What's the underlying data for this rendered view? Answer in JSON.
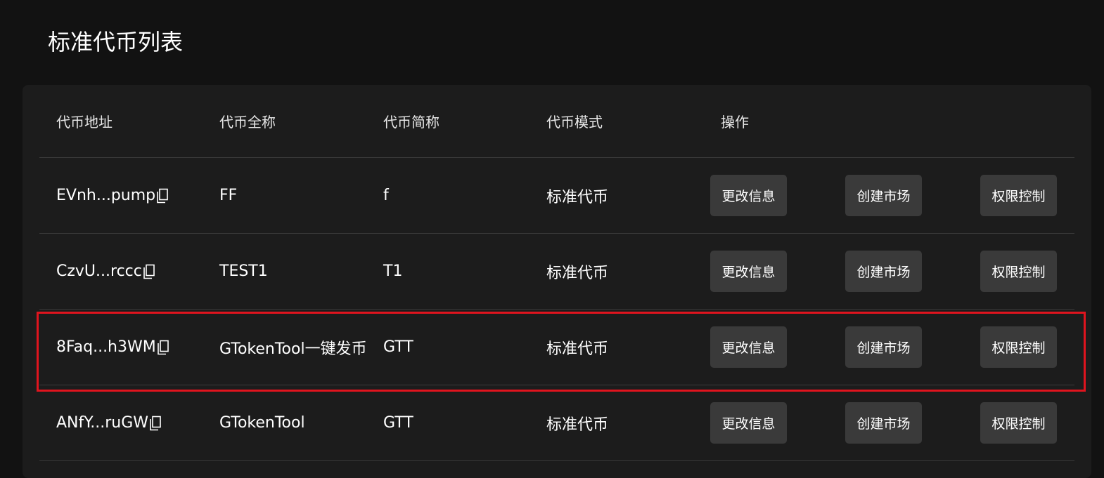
{
  "page": {
    "title": "标准代币列表"
  },
  "table": {
    "columns": [
      "代币地址",
      "代币全称",
      "代币简称",
      "代币模式",
      "操作"
    ],
    "rows": [
      {
        "address": "EVnh...pump",
        "name": "FF",
        "symbol": "f",
        "mode": "标准代币"
      },
      {
        "address": "CzvU...rccc",
        "name": "TEST1",
        "symbol": "T1",
        "mode": "标准代币"
      },
      {
        "address": "8Faq...h3WM",
        "name": "GTokenTool一键发币",
        "symbol": "GTT",
        "mode": "标准代币"
      },
      {
        "address": "ANfY...ruGW",
        "name": "GTokenTool",
        "symbol": "GTT",
        "mode": "标准代币"
      }
    ],
    "actions": {
      "edit_label": "更改信息",
      "market_label": "创建市场",
      "permission_label": "权限控制"
    },
    "icons": {
      "copy": "copy-icon"
    }
  },
  "colors": {
    "background": "#121212",
    "card": "#1c1c1c",
    "button": "#3a3a3a",
    "highlight": "#e0141e"
  }
}
